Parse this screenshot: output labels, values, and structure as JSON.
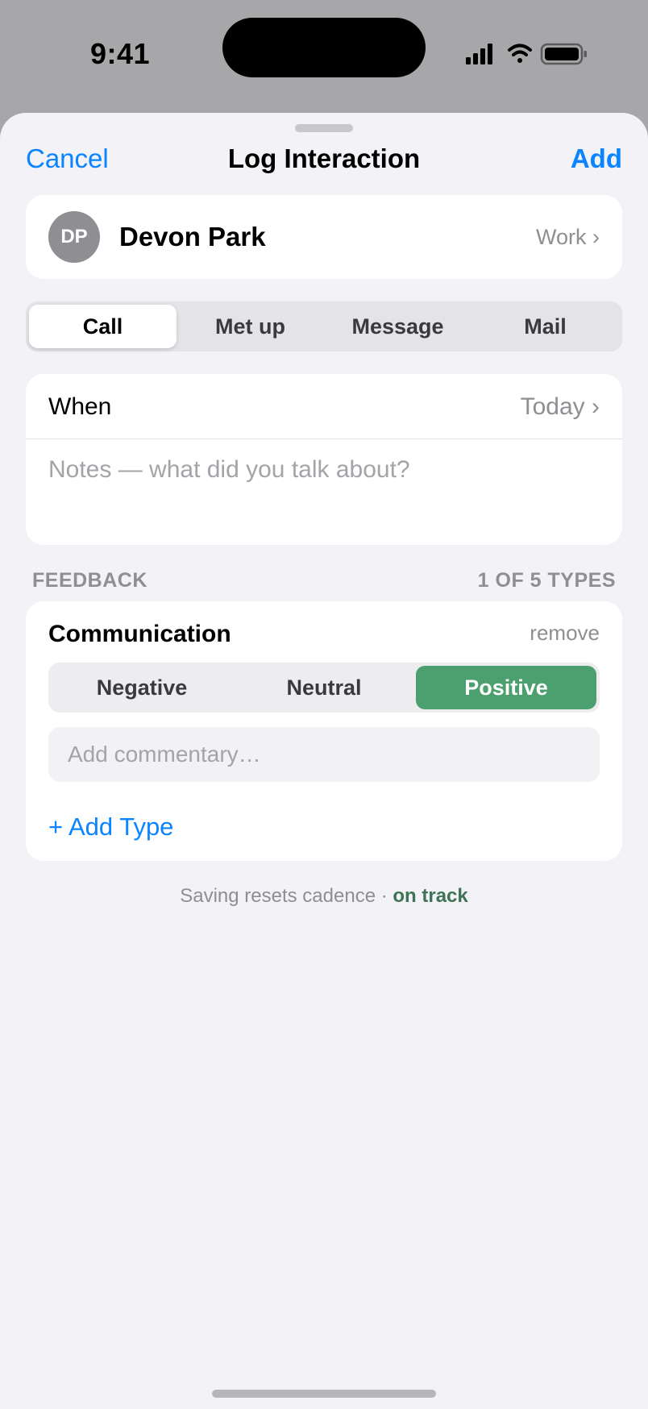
{
  "status_bar": {
    "time": "9:41",
    "icons": [
      "cellular-signal-icon",
      "wifi-icon",
      "battery-icon"
    ]
  },
  "nav": {
    "cancel": "Cancel",
    "title": "Log Interaction",
    "add": "Add"
  },
  "contact": {
    "initials": "DP",
    "name": "Devon Park",
    "group": "Work ›"
  },
  "interaction_types": {
    "options": [
      "Call",
      "Met up",
      "Message",
      "Mail"
    ],
    "selected": "Call"
  },
  "details": {
    "when_label": "When",
    "when_value": "Today ›",
    "notes_placeholder": "Notes — what did you talk about?",
    "notes_value": ""
  },
  "feedback": {
    "header": "FEEDBACK",
    "count": "1 OF 5 TYPES",
    "entries": [
      {
        "type": "Communication",
        "remove_label": "remove",
        "options": [
          "Negative",
          "Neutral",
          "Positive"
        ],
        "selected": "Positive",
        "commentary_placeholder": "Add commentary…"
      }
    ],
    "add_type": "+ Add Type"
  },
  "footer": {
    "note": "Saving resets cadence ·",
    "status": "on track"
  },
  "colors": {
    "accent": "#0a84ff",
    "positive": "#4c9f6f",
    "status_good": "#3f7355",
    "sheet_background": "#f2f2f7"
  }
}
